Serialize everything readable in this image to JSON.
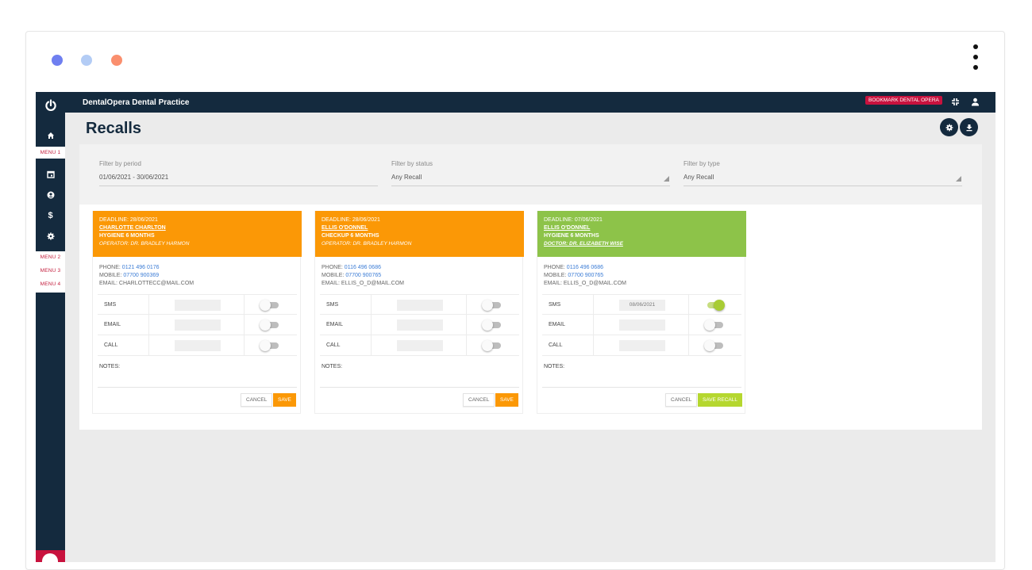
{
  "window": {
    "dot_colors": [
      "#6f7ff0",
      "#b3ccf5",
      "#fa8f6e"
    ]
  },
  "sidebar": {
    "menus": [
      "MENU 1",
      "MENU 2",
      "MENU 3",
      "MENU 4"
    ],
    "icons": [
      "power-icon",
      "home-icon",
      "calendar-icon",
      "user-circle-icon",
      "dollar-icon",
      "gear-icon"
    ]
  },
  "topbar": {
    "title": "DentalOpera Dental Practice",
    "bookmark": "BOOKMARK DENTAL OPERA"
  },
  "page": {
    "title": "Recalls"
  },
  "filters": {
    "period": {
      "label": "Filter by period",
      "value": "01/06/2021 - 30/06/2021"
    },
    "status": {
      "label": "Filter by status",
      "value": "Any Recall"
    },
    "type": {
      "label": "Filter by type",
      "value": "Any Recall"
    }
  },
  "labels": {
    "sms": "SMS",
    "email": "EMAIL",
    "call": "CALL",
    "notes": "NOTES:",
    "cancel": "CANCEL"
  },
  "cards": [
    {
      "header_color": "#fb9806",
      "deadline": "DEADLINE: 28/06/2021",
      "patient": "CHARLOTTE CHARLTON",
      "treatment": "HYGIENE 6 MONTHS",
      "operator": "OPERATOR: DR. BRADLEY HARMON",
      "phone_label": "PHONE:",
      "phone": "0121 496 0176",
      "mobile_label": "MOBILE:",
      "mobile": "07700 900369",
      "email_line": "EMAIL: CHARLOTTECC@MAIL.COM",
      "sms_date": "",
      "sms_on": false,
      "save_label": "SAVE",
      "save_color": "#fb9806"
    },
    {
      "header_color": "#fb9806",
      "deadline": "DEADLINE: 28/06/2021",
      "patient": "ELLIS O'DONNEL",
      "treatment": "CHECKUP 6 MONTHS",
      "operator": "OPERATOR: DR. BRADLEY HARMON",
      "phone_label": "PHONE:",
      "phone": "0116 496 0686",
      "mobile_label": "MOBILE:",
      "mobile": "07700 900765",
      "email_line": "EMAIL: ELLIS_O_D@MAIL.COM",
      "sms_date": "",
      "sms_on": false,
      "save_label": "SAVE",
      "save_color": "#fb9806"
    },
    {
      "header_color": "#8dc349",
      "deadline": "DEADLINE: 07/06/2021",
      "patient": "ELLIS O'DONNEL",
      "treatment": "HYGIENE 6 MONTHS",
      "operator": "DOCTOR: DR. ELIZABETH WISE",
      "phone_label": "PHONE:",
      "phone": "0116 496 0686",
      "mobile_label": "MOBILE:",
      "mobile": "07700 900765",
      "email_line": "EMAIL: ELLIS_O_D@MAIL.COM",
      "sms_date": "08/06/2021",
      "sms_on": true,
      "save_label": "SAVE RECALL",
      "save_color": "#b5d72f"
    }
  ]
}
